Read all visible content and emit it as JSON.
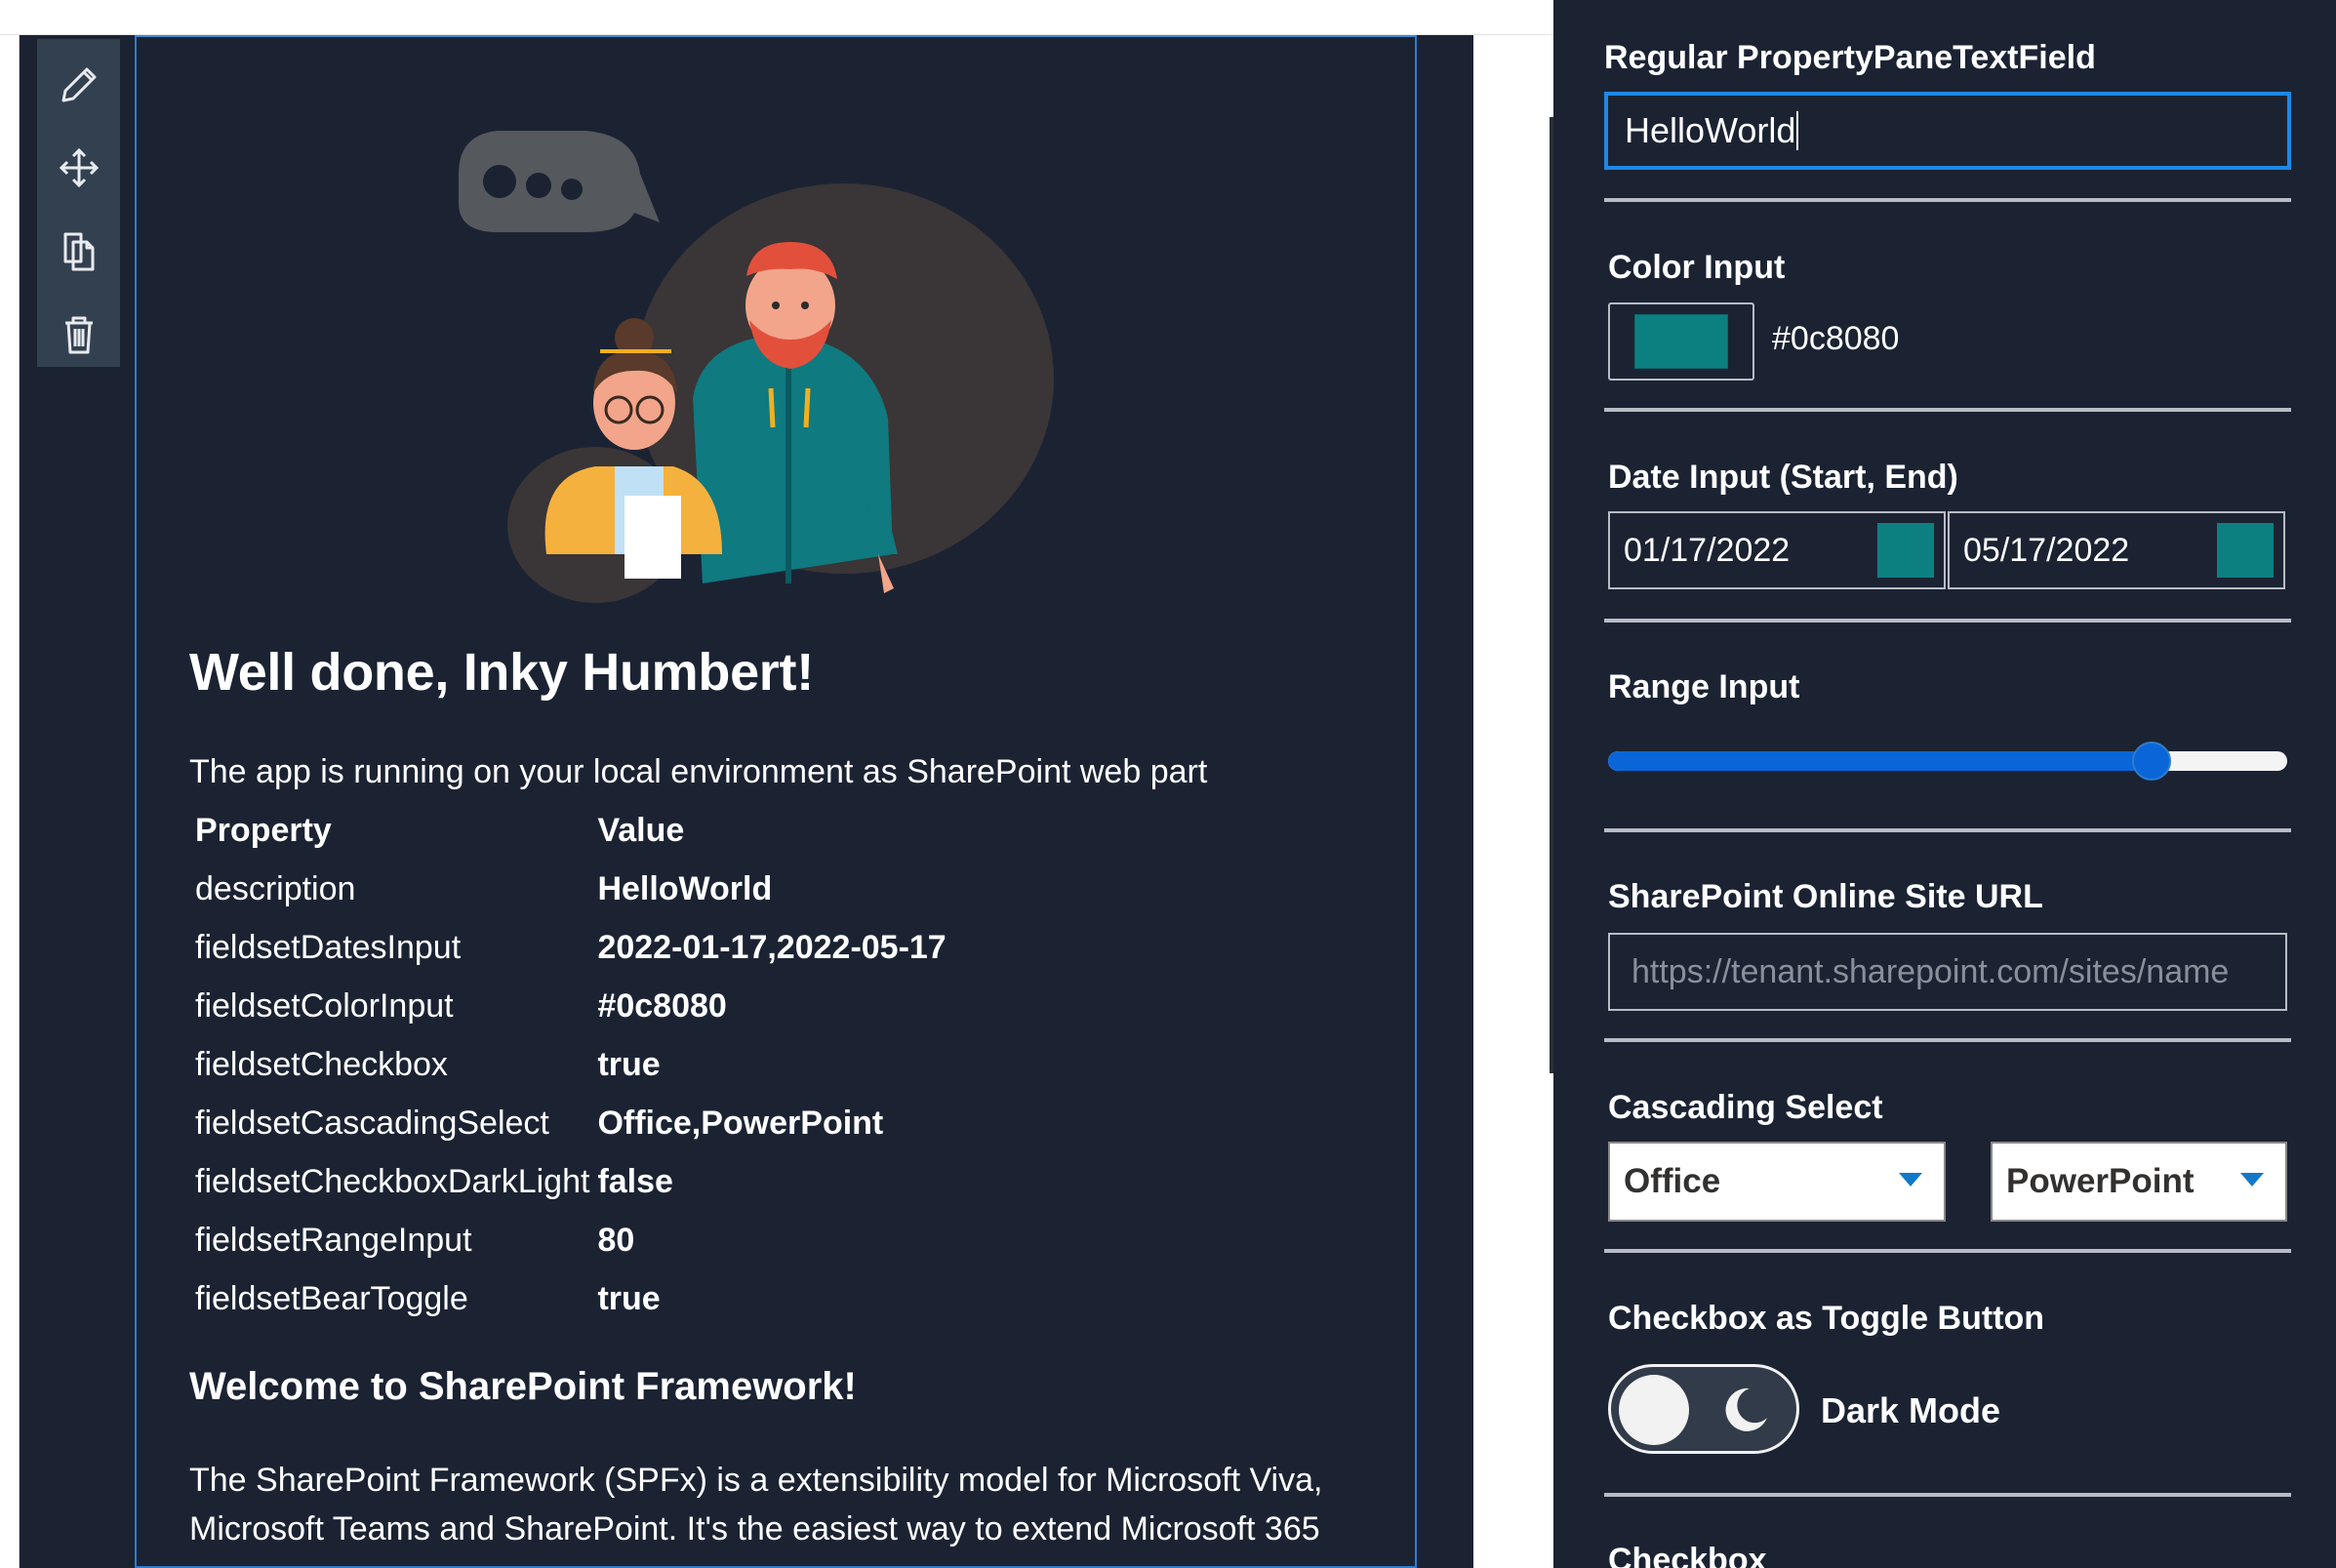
{
  "toolbar": {
    "icons": [
      "pencil-icon",
      "move-icon",
      "duplicate-icon",
      "trash-icon"
    ]
  },
  "webpart": {
    "greeting": "Well done, Inky Humbert!",
    "intro": "The app is running on your local environment as SharePoint web part",
    "table": {
      "header_property": "Property",
      "header_value": "Value",
      "rows": [
        {
          "property": "description",
          "value": "HelloWorld"
        },
        {
          "property": "fieldsetDatesInput",
          "value": "2022-01-17,2022-05-17"
        },
        {
          "property": "fieldsetColorInput",
          "value": "#0c8080"
        },
        {
          "property": "fieldsetCheckbox",
          "value": "true"
        },
        {
          "property": "fieldsetCascadingSelect",
          "value": "Office,PowerPoint"
        },
        {
          "property": "fieldsetCheckboxDarkLight",
          "value": "false"
        },
        {
          "property": "fieldsetRangeInput",
          "value": "80"
        },
        {
          "property": "fieldsetBearToggle",
          "value": "true"
        }
      ]
    },
    "subheading": "Welcome to SharePoint Framework!",
    "body_line1": "The SharePoint Framework (SPFx) is a extensibility model for Microsoft Viva,",
    "body_line2": "Microsoft Teams and SharePoint. It's the easiest way to extend Microsoft 365"
  },
  "pane": {
    "text_field": {
      "label": "Regular PropertyPaneTextField",
      "value": "HelloWorld"
    },
    "color": {
      "label": "Color Input",
      "value": "#0c8080"
    },
    "dates": {
      "label": "Date Input (Start, End)",
      "start": "01/17/2022",
      "end": "05/17/2022"
    },
    "range": {
      "label": "Range Input",
      "value": 80,
      "min": 0,
      "max": 100
    },
    "url": {
      "label": "SharePoint Online Site URL",
      "placeholder": "https://tenant.sharepoint.com/sites/name"
    },
    "cascading": {
      "label": "Cascading Select",
      "first": "Office",
      "second": "PowerPoint"
    },
    "toggle": {
      "label": "Checkbox as Toggle Button",
      "text": "Dark Mode",
      "checked": false
    },
    "checkbox": {
      "label": "Checkbox"
    }
  },
  "colors": {
    "background": "#1b2333",
    "accent": "#0c8080",
    "focus_blue": "#1e88e5",
    "range_blue": "#0a66d8"
  }
}
